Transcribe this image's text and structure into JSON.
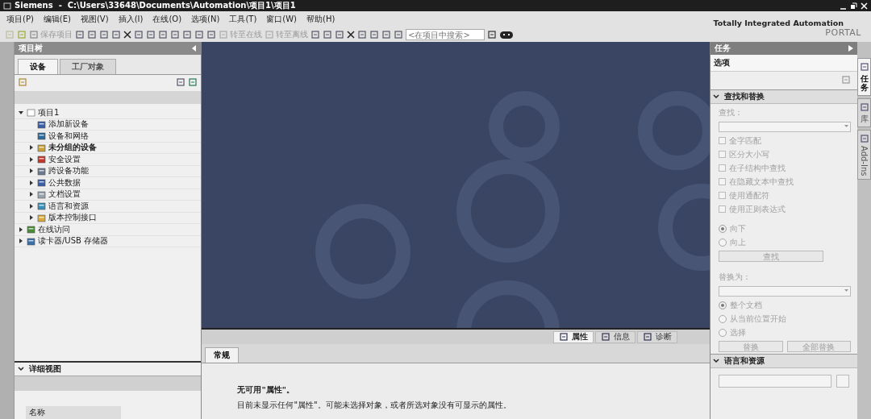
{
  "window": {
    "title": "Siemens  -  C:\\Users\\33648\\Documents\\Automation\\项目1\\项目1"
  },
  "menu": [
    "项目(P)",
    "编辑(E)",
    "视图(V)",
    "插入(I)",
    "在线(O)",
    "选项(N)",
    "工具(T)",
    "窗口(W)",
    "帮助(H)"
  ],
  "toolbar": {
    "save_label": "保存项目",
    "online_label": "转至在线",
    "offline_label": "转至离线",
    "search": {
      "placeholder": "<在项目中搜索>"
    }
  },
  "brand": {
    "line1": "Totally Integrated Automation",
    "line2": "PORTAL"
  },
  "project_tree": {
    "title": "项目树",
    "tabs": [
      {
        "label": "设备",
        "selected": true
      },
      {
        "label": "工厂对象",
        "selected": false
      }
    ],
    "items": [
      {
        "label": "项目1",
        "expanded": true,
        "children": [
          {
            "label": "添加新设备"
          },
          {
            "label": "设备和网络"
          },
          {
            "label": "未分组的设备",
            "expanded": false,
            "bold": true
          },
          {
            "label": "安全设置",
            "expanded": false
          },
          {
            "label": "跨设备功能",
            "expanded": false
          },
          {
            "label": "公共数据",
            "expanded": false
          },
          {
            "label": "文档设置",
            "expanded": false
          },
          {
            "label": "语言和资源",
            "expanded": false
          },
          {
            "label": "版本控制接口",
            "expanded": false
          }
        ]
      },
      {
        "label": "在线访问",
        "expanded": false
      },
      {
        "label": "读卡器/USB 存储器",
        "expanded": false
      }
    ]
  },
  "detail_view": {
    "title": "详细视图",
    "column": "名称"
  },
  "inspector": {
    "tabs": [
      {
        "label": "属性",
        "selected": true
      },
      {
        "label": "信息",
        "selected": false
      },
      {
        "label": "诊断",
        "selected": false
      }
    ],
    "subtabs": [
      {
        "label": "常规",
        "selected": true
      }
    ],
    "heading": "无可用\"属性\"。",
    "message": "目前未显示任何\"属性\"。可能未选择对象，或者所选对象没有可显示的属性。"
  },
  "tasks": {
    "title": "任务",
    "options_title": "选项",
    "find_replace": {
      "title": "查找和替换",
      "find_label": "查找：",
      "checks": [
        {
          "label": "全字匹配",
          "checked": false
        },
        {
          "label": "区分大小写",
          "checked": false
        },
        {
          "label": "在子结构中查找",
          "checked": false
        },
        {
          "label": "在隐藏文本中查找",
          "checked": false
        },
        {
          "label": "使用通配符",
          "checked": false
        },
        {
          "label": "使用正则表达式",
          "checked": false
        }
      ],
      "direction": [
        {
          "label": "向下",
          "selected": true
        },
        {
          "label": "向上",
          "selected": false
        }
      ],
      "find_button": "查找",
      "replace_label": "替换为：",
      "scope": [
        {
          "label": "整个文档",
          "selected": true
        },
        {
          "label": "从当前位置开始",
          "selected": false
        },
        {
          "label": "选择",
          "selected": false
        }
      ],
      "buttons": [
        "替换",
        "全部替换"
      ]
    },
    "language": {
      "title": "语言和资源"
    }
  },
  "side_tabs": [
    {
      "label": "任务",
      "kind": "cjk",
      "selected": true
    },
    {
      "label": "库",
      "kind": "cjk",
      "selected": false
    },
    {
      "label": "Add-Ins",
      "kind": "latin",
      "selected": false
    }
  ]
}
